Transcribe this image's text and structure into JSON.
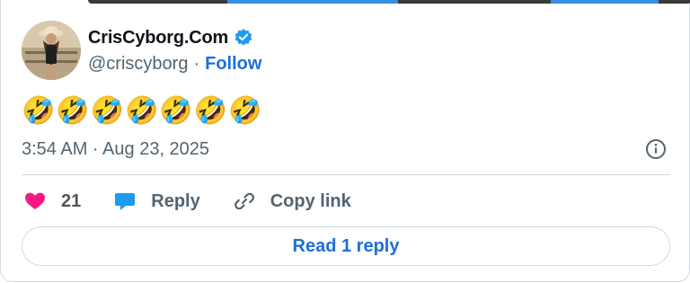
{
  "author": {
    "display_name": "CrisCyborg.Com",
    "handle": "@criscyborg",
    "separator": "·",
    "follow_label": "Follow",
    "verified_color": "#1d9bf0"
  },
  "tweet": {
    "text": "🤣🤣🤣🤣🤣🤣🤣",
    "time": "3:54 AM · Aug 23, 2025"
  },
  "actions": {
    "likes_count": "21",
    "reply_label": "Reply",
    "copy_link_label": "Copy link"
  },
  "read_replies_label": "Read 1 reply",
  "colors": {
    "accent": "#1d6fd8",
    "like": "#f91880",
    "reply_icon": "#1d9bf0",
    "muted": "#536471"
  }
}
